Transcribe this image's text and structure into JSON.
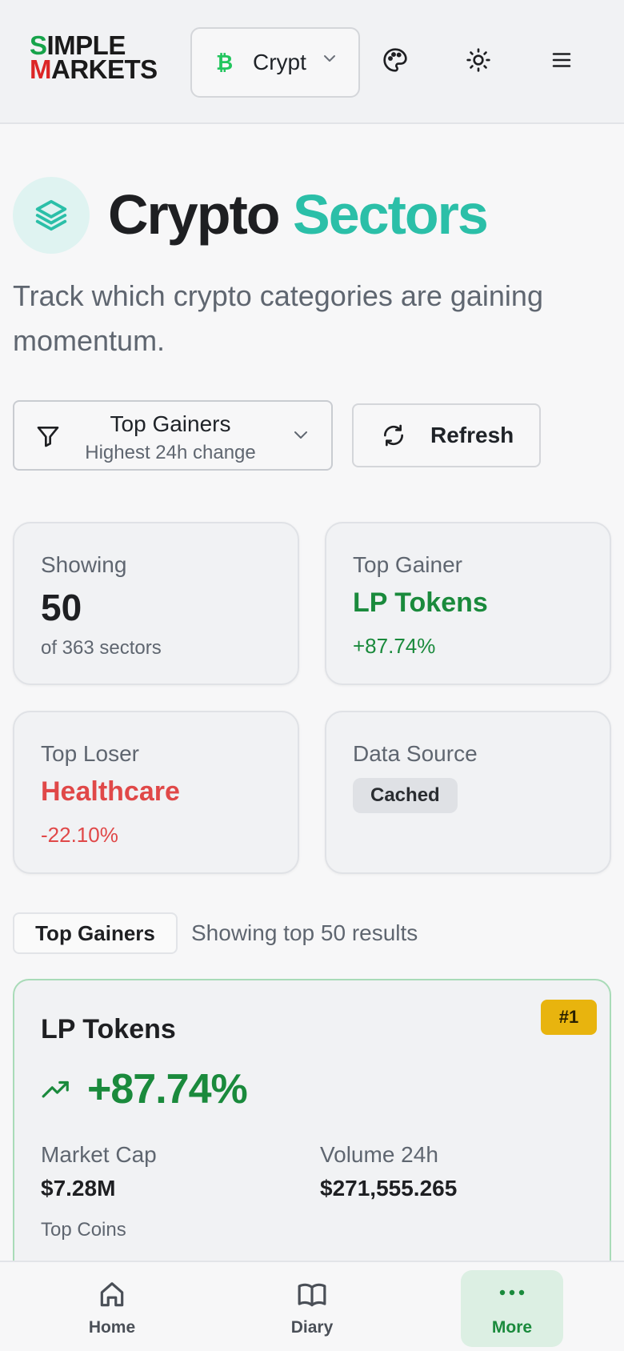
{
  "header": {
    "logo_line1_first": "S",
    "logo_line1_rest": "IMPLE",
    "logo_line2_first": "M",
    "logo_line2_rest": "ARKETS",
    "market_select": {
      "icon": "bitcoin-icon",
      "value": "Crypt"
    },
    "icons": [
      "palette-icon",
      "sun-icon",
      "menu-icon"
    ]
  },
  "title": {
    "icon": "layers-icon",
    "word1": "Crypto",
    "word2": "Sectors",
    "subtitle": "Track which crypto categories are gaining momentum."
  },
  "filter": {
    "selected": "Top Gainers",
    "description": "Highest 24h change",
    "refresh_label": "Refresh"
  },
  "stats": {
    "showing": {
      "label": "Showing",
      "value": "50",
      "sub": "of 363 sectors"
    },
    "top_gainer": {
      "label": "Top Gainer",
      "value": "LP Tokens",
      "sub": "+87.74%"
    },
    "top_loser": {
      "label": "Top Loser",
      "value": "Healthcare",
      "sub": "-22.10%"
    },
    "data_source": {
      "label": "Data Source",
      "value": "Cached"
    }
  },
  "section": {
    "chip": "Top Gainers",
    "count_text": "Showing top 50 results"
  },
  "sectors": [
    {
      "name": "LP Tokens",
      "rank": "#1",
      "change": "+87.74%",
      "market_cap_label": "Market Cap",
      "market_cap": "$7.28M",
      "volume_label": "Volume 24h",
      "volume": "$271,555.265",
      "top_coins_label": "Top Coins"
    }
  ],
  "nav": [
    {
      "label": "Home",
      "icon": "home-icon",
      "active": false
    },
    {
      "label": "Diary",
      "icon": "book-icon",
      "active": false
    },
    {
      "label": "More",
      "icon": "more-icon",
      "active": true
    }
  ],
  "colors": {
    "accent_teal": "#2bbfa8",
    "gain_green": "#1a8a3c",
    "loss_red": "#e04848",
    "rank_badge": "#e8b40e"
  }
}
